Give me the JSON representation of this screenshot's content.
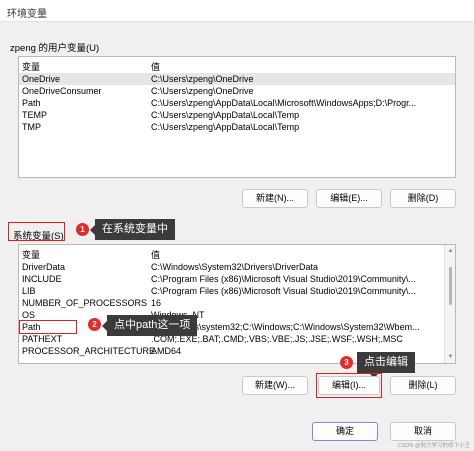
{
  "window": {
    "title": "环境变量"
  },
  "user_vars": {
    "group_label": "zpeng 的用户变量(U)",
    "headers": {
      "name": "变量",
      "value": "值"
    },
    "rows": [
      {
        "name": "OneDrive",
        "value": "C:\\Users\\zpeng\\OneDrive"
      },
      {
        "name": "OneDriveConsumer",
        "value": "C:\\Users\\zpeng\\OneDrive"
      },
      {
        "name": "Path",
        "value": "C:\\Users\\zpeng\\AppData\\Local\\Microsoft\\WindowsApps;D:\\Progr..."
      },
      {
        "name": "TEMP",
        "value": "C:\\Users\\zpeng\\AppData\\Local\\Temp"
      },
      {
        "name": "TMP",
        "value": "C:\\Users\\zpeng\\AppData\\Local\\Temp"
      }
    ],
    "buttons": {
      "new": "新建(N)...",
      "edit": "编辑(E)...",
      "delete": "删除(D)"
    }
  },
  "system_vars": {
    "group_label": "系统变量(S)",
    "headers": {
      "name": "变量",
      "value": "值"
    },
    "rows": [
      {
        "name": "DriverData",
        "value": "C:\\Windows\\System32\\Drivers\\DriverData"
      },
      {
        "name": "INCLUDE",
        "value": "C:\\Program Files (x86)\\Microsoft Visual Studio\\2019\\Community\\..."
      },
      {
        "name": "LIB",
        "value": "C:\\Program Files (x86)\\Microsoft Visual Studio\\2019\\Community\\..."
      },
      {
        "name": "NUMBER_OF_PROCESSORS",
        "value": "16"
      },
      {
        "name": "OS",
        "value": "Windows_NT"
      },
      {
        "name": "Path",
        "value": "C:\\Windows\\system32;C:\\Windows;C:\\Windows\\System32\\Wbem..."
      },
      {
        "name": "PATHEXT",
        "value": ".COM;.EXE;.BAT;.CMD;.VBS;.VBE;.JS;.JSE;.WSF;.WSH;.MSC"
      },
      {
        "name": "PROCESSOR_ARCHITECTURE",
        "value": "AMD64"
      }
    ],
    "buttons": {
      "new": "新建(W)...",
      "edit": "编辑(I)...",
      "delete": "删除(L)"
    }
  },
  "dialog_buttons": {
    "ok": "确定",
    "cancel": "取消"
  },
  "annotations": [
    {
      "number": "1",
      "text": "在系统变量中"
    },
    {
      "number": "2",
      "text": "点中path这一项"
    },
    {
      "number": "3",
      "text": "点击编辑"
    }
  ],
  "watermark": "CSDN @努力学习的修下小王",
  "colors": {
    "annotation_red": "#e52a2a",
    "callout_bg": "#3b3b3b",
    "selected_row": "#e6e6e6"
  }
}
